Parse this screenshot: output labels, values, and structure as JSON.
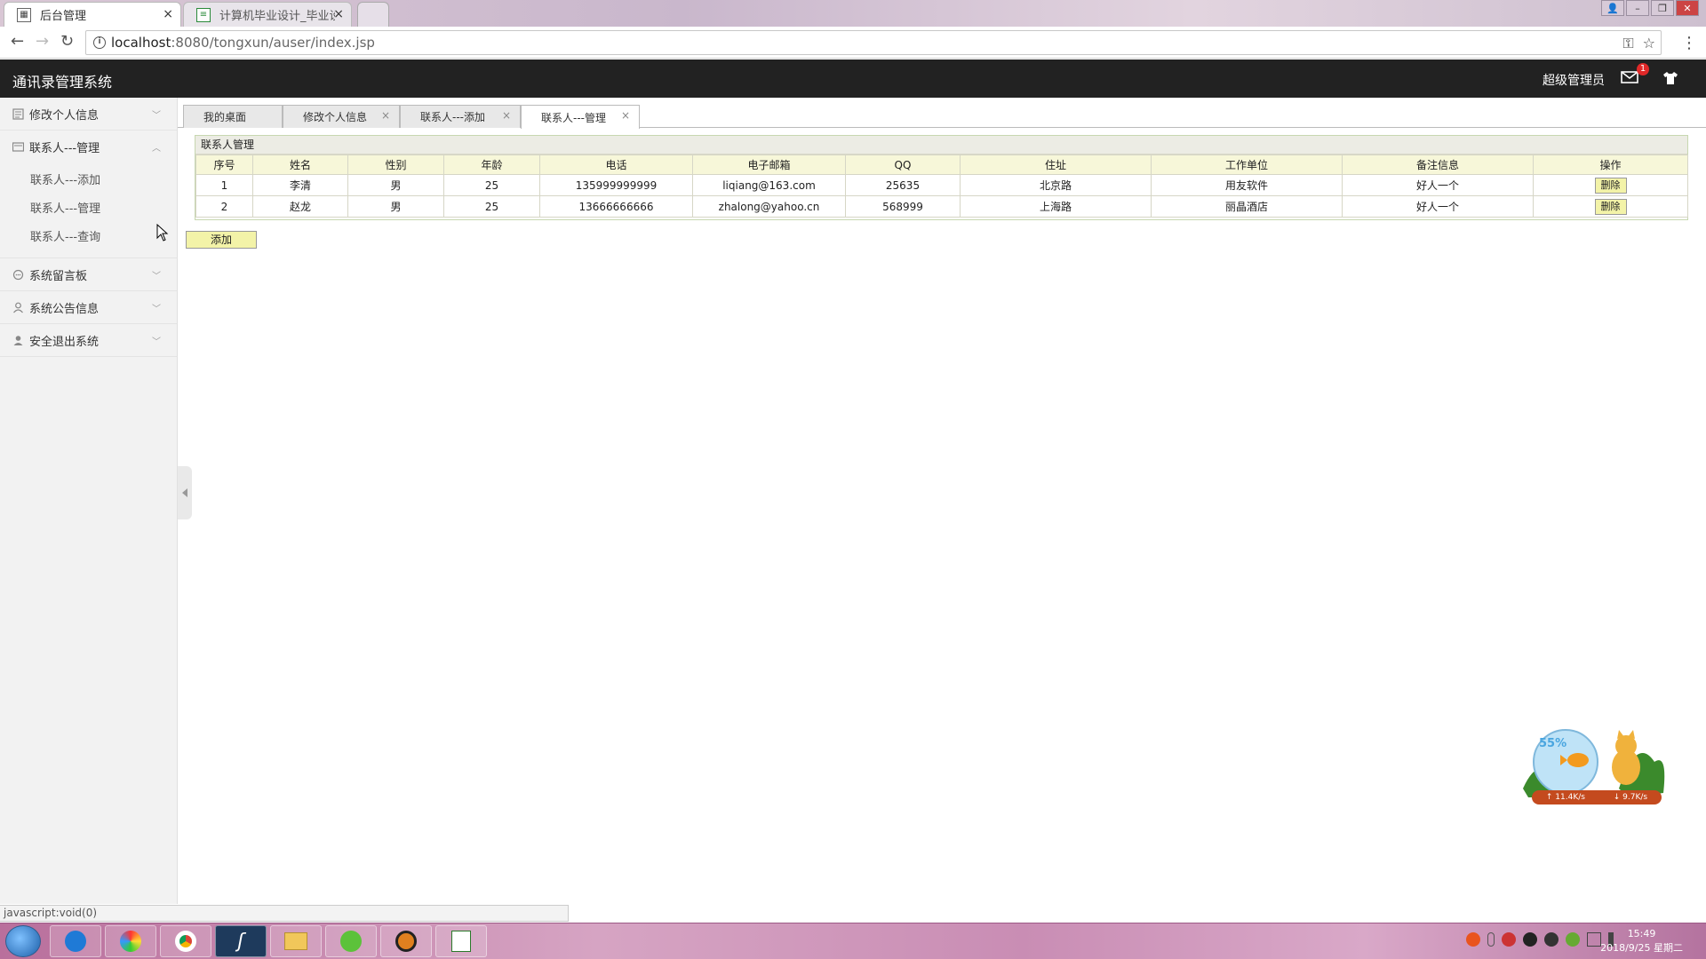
{
  "browser": {
    "tabs": [
      {
        "title": "后台管理",
        "close": "×"
      },
      {
        "title": "计算机毕业设计_毕业设计",
        "close": "×"
      }
    ],
    "url_host": "localhost",
    "url_path": ":8080/tongxun/auser/index.jsp",
    "status_text": "javascript:void(0)"
  },
  "app": {
    "title": "通讯录管理系统",
    "admin": "超级管理员",
    "mail_badge": "1"
  },
  "sidebar": {
    "groups": [
      {
        "label": "修改个人信息",
        "chevron": "﹀"
      },
      {
        "label": "联系人---管理",
        "chevron": "︿",
        "children": [
          "联系人---添加",
          "联系人---管理",
          "联系人---查询"
        ]
      },
      {
        "label": "系统留言板",
        "chevron": "﹀"
      },
      {
        "label": "系统公告信息",
        "chevron": "﹀"
      },
      {
        "label": "安全退出系统",
        "chevron": "﹀"
      }
    ]
  },
  "content_tabs": [
    {
      "label": "我的桌面"
    },
    {
      "label": "修改个人信息",
      "close": "×"
    },
    {
      "label": "联系人---添加",
      "close": "×"
    },
    {
      "label": "联系人---管理",
      "close": "×"
    }
  ],
  "panel": {
    "title": "联系人管理",
    "columns": [
      "序号",
      "姓名",
      "性别",
      "年龄",
      "电话",
      "电子邮箱",
      "QQ",
      "住址",
      "工作单位",
      "备注信息",
      "操作"
    ],
    "rows": [
      {
        "id": "1",
        "name": "李清",
        "gender": "男",
        "age": "25",
        "phone": "135999999999",
        "email": "liqiang@163.com",
        "qq": "25635",
        "address": "北京路",
        "company": "用友软件",
        "note": "好人一个",
        "action": "删除"
      },
      {
        "id": "2",
        "name": "赵龙",
        "gender": "男",
        "age": "25",
        "phone": "13666666666",
        "email": "zhalong@yahoo.cn",
        "qq": "568999",
        "address": "上海路",
        "company": "丽晶酒店",
        "note": "好人一个",
        "action": "删除"
      }
    ],
    "add_label": "添加"
  },
  "widget": {
    "percent": "55%",
    "up_speed": "↑ 11.4K/s",
    "down_speed": "↓ 9.7K/s"
  },
  "taskbar": {
    "time": "15:49",
    "date": "2018/9/25 星期二"
  },
  "colors": {
    "header_bg": "#222222",
    "table_header_bg": "#f7f7d9",
    "button_bg": "#f3f3a8",
    "badge": "#e02828"
  }
}
